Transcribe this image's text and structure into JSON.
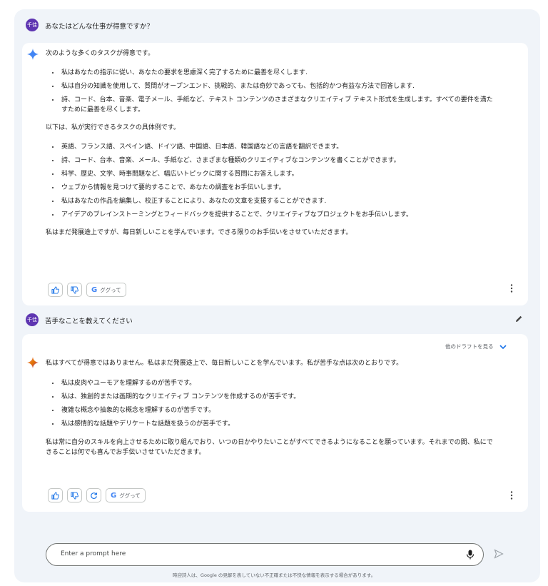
{
  "conversation": {
    "user1": {
      "avatar": "千佳",
      "text": "あなたはどんな仕事が得意ですか？"
    },
    "resp1": {
      "intro": "次のような多くのタスクが得意です。",
      "list1": [
        "私はあなたの指示に従い、あなたの要求を思慮深く完了するために最善を尽くします.",
        "私は自分の知識を使用して、質問がオープンエンド、挑戦的、または奇妙であっても、包括的かつ有益な方法で回答します.",
        "詩、コード、台本、音楽、電子メール、手紙など、テキスト コンテンツのさまざまなクリエイティブ テキスト形式を生成します。すべての要件を満たすために最善を尽くします。"
      ],
      "mid": "以下は、私が実行できるタスクの具体例です。",
      "list2": [
        "英語、フランス語、スペイン語、ドイツ語、中国語、日本語、韓国語などの言語を翻訳できます。",
        "詩、コード、台本、音楽、メール、手紙など、さまざまな種類のクリエイティブなコンテンツを書くことができます。",
        "科学、歴史、文学、時事問題など、幅広いトピックに関する質問にお答えします。",
        "ウェブから情報を見つけて要約することで、あなたの調査をお手伝いします。",
        "私はあなたの作品を編集し、校正することにより、あなたの文章を支援することができます.",
        "アイデアのブレインストーミングとフィードバックを提供することで、クリエイティブなプロジェクトをお手伝いします。"
      ],
      "outro": "私はまだ発展途上ですが、毎日新しいことを学んでいます。できる限りのお手伝いをさせていただきます。",
      "google_label": "ググって"
    },
    "user2": {
      "avatar": "千佳",
      "text": "苦手なことを教えてください"
    },
    "resp2": {
      "drafts_label": "他のドラフトを見る",
      "intro": "私はすべてが得意ではありません。私はまだ発展途上で、毎日新しいことを学んでいます。私が苦手な点は次のとおりです。",
      "list": [
        "私は皮肉やユーモアを理解するのが苦手です。",
        "私は、独創的または画期的なクリエイティブ コンテンツを作成するのが苦手です。",
        "複雑な概念や抽象的な概念を理解するのが苦手です。",
        "私は感情的な話題やデリケートな話題を扱うのが苦手です。"
      ],
      "outro": "私は常に自分のスキルを向上させるために取り組んでおり、いつの日かやりたいことがすべてできるようになることを願っています。それまでの間、私にできることは何でも喜んでお手伝いさせていただきます。",
      "google_label": "ググって"
    }
  },
  "prompt": {
    "placeholder": "Enter a prompt here",
    "disclaimer": "時迎詩人は、Google の見解を表していない不正確または不快な情報を表示する場合があります。"
  },
  "colors": {
    "accent": "#1a73e8",
    "avatar": "#5e35b1",
    "panel": "#f0f4f9"
  }
}
